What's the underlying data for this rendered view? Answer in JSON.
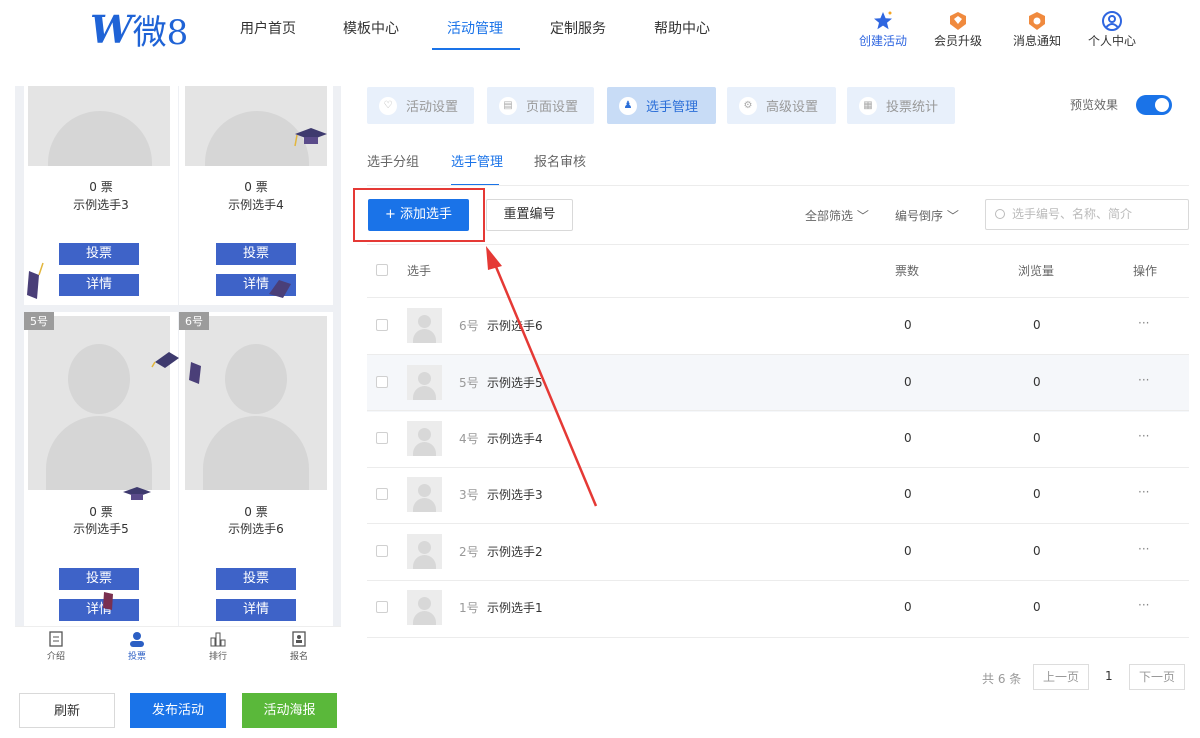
{
  "brand": {
    "logo_mark": "W",
    "logo_text": "微8"
  },
  "nav": {
    "items": [
      "用户首页",
      "模板中心",
      "活动管理",
      "定制服务",
      "帮助中心"
    ],
    "active_index": 2,
    "right": [
      {
        "label": "创建活动",
        "icon": "star-icon"
      },
      {
        "label": "会员升级",
        "icon": "vip-badge-icon"
      },
      {
        "label": "消息通知",
        "icon": "bell-badge-icon"
      },
      {
        "label": "个人中心",
        "icon": "user-circle-icon"
      }
    ]
  },
  "preview": {
    "cards": [
      {
        "votes": "0 票",
        "name": "示例选手3",
        "vote_label": "投票",
        "detail_label": "详情"
      },
      {
        "votes": "0 票",
        "name": "示例选手4",
        "vote_label": "投票",
        "detail_label": "详情"
      },
      {
        "badge": "5号",
        "votes": "0 票",
        "name": "示例选手5",
        "vote_label": "投票",
        "detail_label": "详情"
      },
      {
        "badge": "6号",
        "votes": "0 票",
        "name": "示例选手6",
        "vote_label": "投票",
        "detail_label": "详情"
      }
    ],
    "tabs": [
      "介绍",
      "投票",
      "排行",
      "报名"
    ],
    "active_tab": 1
  },
  "actions": {
    "refresh": "刷新",
    "publish": "发布活动",
    "poster": "活动海报"
  },
  "settings_tabs": [
    "活动设置",
    "页面设置",
    "选手管理",
    "高级设置",
    "投票统计"
  ],
  "settings_active": 2,
  "preview_toggle": {
    "label": "预览效果",
    "on": true
  },
  "sub_tabs": [
    "选手分组",
    "选手管理",
    "报名审核"
  ],
  "sub_active": 1,
  "toolbar": {
    "add": "+ 添加选手",
    "reset": "重置编号",
    "filter_all": "全部筛选",
    "sort": "编号倒序",
    "search_placeholder": "选手编号、名称、简介"
  },
  "table": {
    "headers": {
      "contestant": "选手",
      "votes": "票数",
      "views": "浏览量",
      "ops": "操作"
    },
    "rows": [
      {
        "num": "6号",
        "name": "示例选手6",
        "votes": "0",
        "views": "0",
        "ops": "···"
      },
      {
        "num": "5号",
        "name": "示例选手5",
        "votes": "0",
        "views": "0",
        "ops": "···"
      },
      {
        "num": "4号",
        "name": "示例选手4",
        "votes": "0",
        "views": "0",
        "ops": "···"
      },
      {
        "num": "3号",
        "name": "示例选手3",
        "votes": "0",
        "views": "0",
        "ops": "···"
      },
      {
        "num": "2号",
        "name": "示例选手2",
        "votes": "0",
        "views": "0",
        "ops": "···"
      },
      {
        "num": "1号",
        "name": "示例选手1",
        "votes": "0",
        "views": "0",
        "ops": "···"
      }
    ]
  },
  "pager": {
    "total": "共 6 条",
    "prev": "上一页",
    "page": "1",
    "next": "下一页"
  },
  "colors": {
    "primary": "#1a73e8",
    "vote_button": "#3e63c8",
    "green": "#5ab83a",
    "annotation": "#e53935"
  }
}
